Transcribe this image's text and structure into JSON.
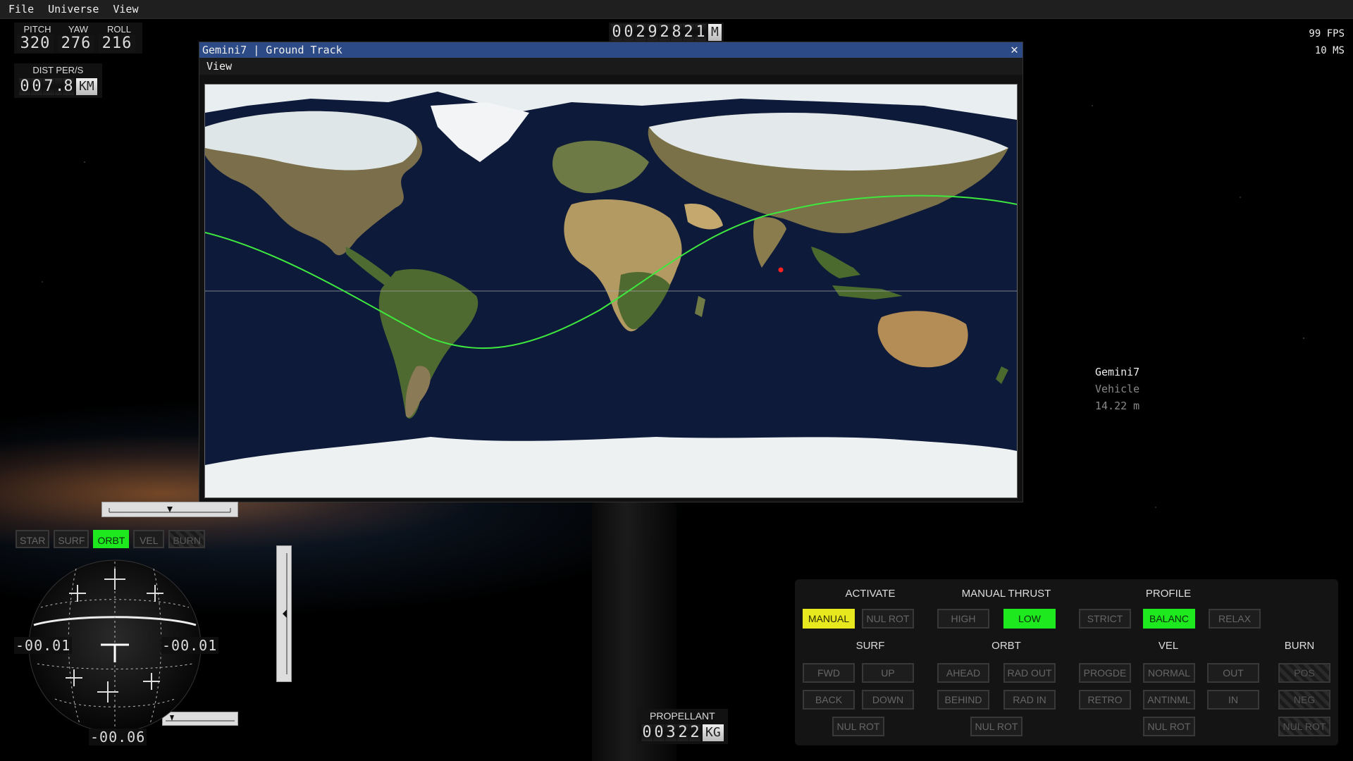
{
  "menu": [
    "File",
    "Universe",
    "View"
  ],
  "attitude": {
    "labels": [
      "PITCH",
      "YAW",
      "ROLL"
    ],
    "values": [
      "320",
      "276",
      "216"
    ]
  },
  "dist": {
    "label": "DIST PER/S",
    "digits": [
      "0",
      "0",
      "7",
      ".",
      "8"
    ],
    "unit": "KM"
  },
  "altitude": {
    "digits": [
      "0",
      "0",
      "2",
      "9",
      "2",
      "8",
      "2",
      "1"
    ],
    "unit": "M"
  },
  "perf": {
    "fps": "99 FPS",
    "ms": "10 MS"
  },
  "window": {
    "title": "Gemini7 | Ground Track",
    "menu_view": "View",
    "close": "✕"
  },
  "vessel": {
    "name": "Gemini7",
    "type": "Vehicle",
    "distance": "14.22 m"
  },
  "modes": [
    {
      "label": "STAR",
      "state": "off"
    },
    {
      "label": "SURF",
      "state": "off"
    },
    {
      "label": "ORBT",
      "state": "on"
    },
    {
      "label": "VEL",
      "state": "off"
    },
    {
      "label": "BURN",
      "state": "disabled"
    }
  ],
  "navball": {
    "left": "-00.01",
    "right": "-00.01",
    "bottom": "-00.06"
  },
  "propellant": {
    "label": "PROPELLANT",
    "digits": [
      "0",
      "0",
      "3",
      "2",
      "2"
    ],
    "unit": "KG"
  },
  "panel": {
    "headers": {
      "activate": "ACTIVATE",
      "manual_thrust": "MANUAL THRUST",
      "profile": "PROFILE",
      "surf": "SURF",
      "orbt": "ORBT",
      "vel": "VEL",
      "burn": "BURN"
    },
    "buttons": {
      "manual": "MANUAL",
      "nul_rot": "NUL ROT",
      "high": "HIGH",
      "low": "LOW",
      "strict": "STRICT",
      "balanc": "BALANC",
      "relax": "RELAX",
      "fwd": "FWD",
      "up": "UP",
      "back": "BACK",
      "down": "DOWN",
      "ahead": "AHEAD",
      "rad_out": "RAD OUT",
      "behind": "BEHIND",
      "rad_in": "RAD IN",
      "progde": "PROGDE",
      "normal": "NORMAL",
      "out": "OUT",
      "retro": "RETRO",
      "antinml": "ANTINML",
      "in": "IN",
      "pos": "POS",
      "neg": "NEG"
    }
  },
  "colors": {
    "track": "#3ee83e",
    "active_green": "#1ee81e",
    "active_yellow": "#e8e81e",
    "title_bar": "#2c4a86",
    "vessel_marker": "#ff2020"
  }
}
